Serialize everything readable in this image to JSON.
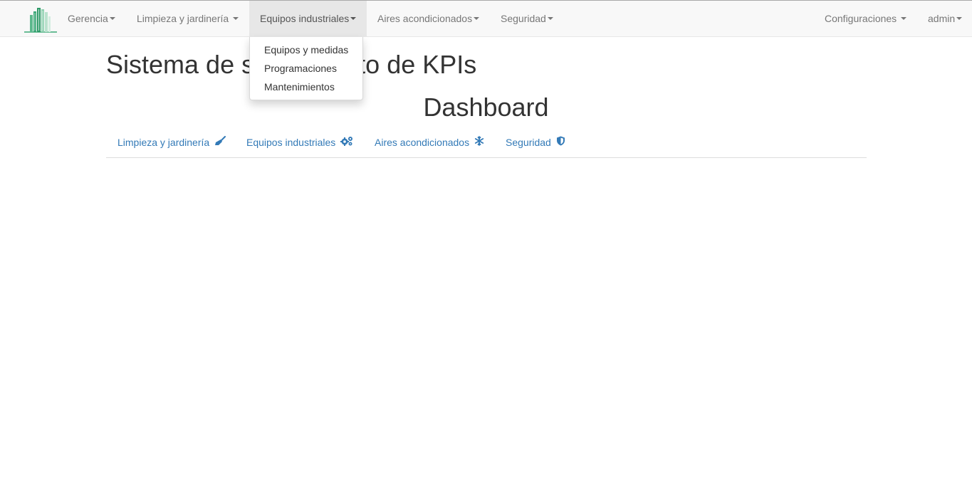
{
  "navbar": {
    "menu": [
      {
        "label": "Gerencia"
      },
      {
        "label": "Limpieza y jardinería"
      },
      {
        "label": "Equipos industriales"
      },
      {
        "label": "Aires acondicionados"
      },
      {
        "label": "Seguridad"
      }
    ],
    "right": [
      {
        "label": "Configuraciones"
      },
      {
        "label": "admin"
      }
    ],
    "active_menu": "Equipos industriales"
  },
  "dropdown": {
    "items": [
      {
        "label": "Equipos y medidas"
      },
      {
        "label": "Programaciones"
      },
      {
        "label": "Mantenimientos"
      }
    ]
  },
  "main": {
    "title": "Sistema de seguimiento de KPIs",
    "subtitle": "Dashboard",
    "tabs": [
      {
        "label": "Limpieza y jardinería",
        "icon": "broom-icon"
      },
      {
        "label": "Equipos industriales",
        "icon": "cogs-icon"
      },
      {
        "label": "Aires acondicionados",
        "icon": "snowflake-icon"
      },
      {
        "label": "Seguridad",
        "icon": "shield-icon"
      }
    ]
  },
  "colors": {
    "link": "#337ab7",
    "navbar_bg": "#f8f8f8",
    "active_bg": "#e7e7e7",
    "logo_green": "#3aa776"
  }
}
